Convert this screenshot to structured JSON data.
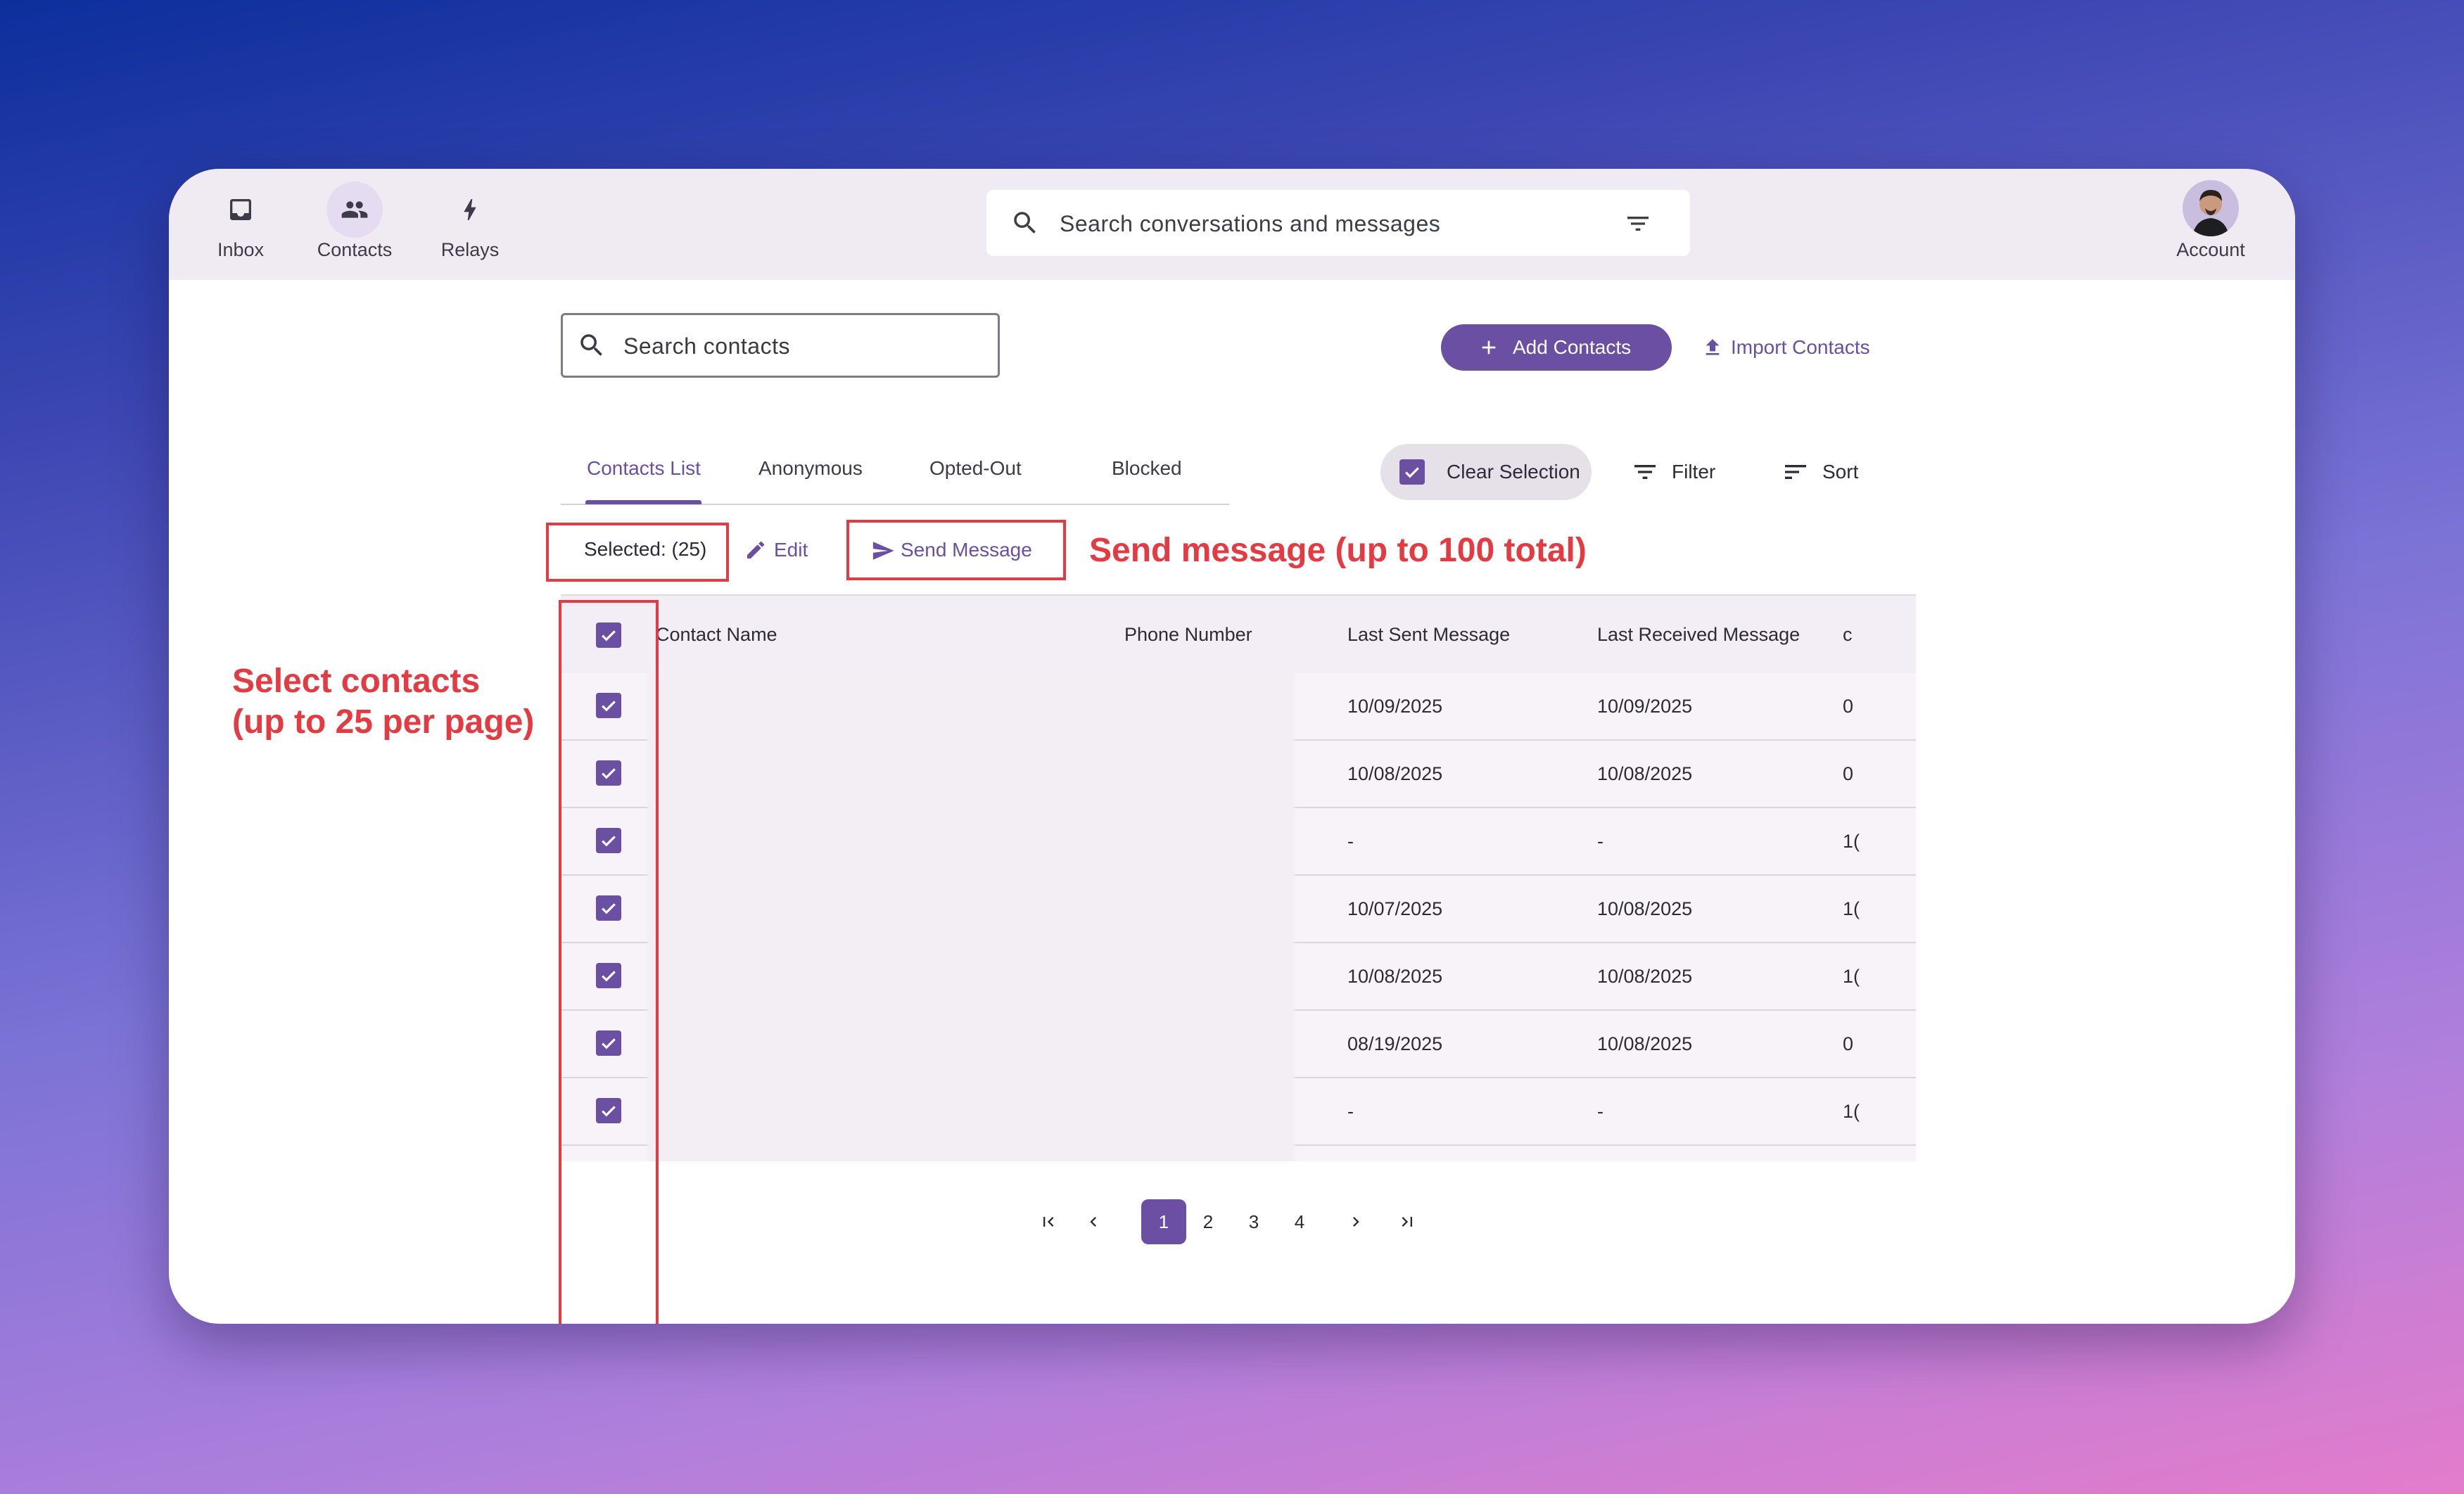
{
  "nav": {
    "items": [
      {
        "label": "Inbox",
        "icon": "inbox-icon"
      },
      {
        "label": "Contacts",
        "icon": "contacts-icon",
        "active": true
      },
      {
        "label": "Relays",
        "icon": "bolt-icon"
      }
    ],
    "search_placeholder": "Search conversations and messages",
    "account_label": "Account"
  },
  "toolbar": {
    "contact_search_placeholder": "Search contacts",
    "add_contacts_label": "Add Contacts",
    "import_contacts_label": "Import Contacts"
  },
  "tabs": [
    {
      "label": "Contacts List",
      "active": true
    },
    {
      "label": "Anonymous"
    },
    {
      "label": "Opted-Out"
    },
    {
      "label": "Blocked"
    }
  ],
  "actions": {
    "clear_selection_label": "Clear Selection",
    "filter_label": "Filter",
    "sort_label": "Sort",
    "selected_label": "Selected: (25)",
    "edit_label": "Edit",
    "send_message_label": "Send Message"
  },
  "table": {
    "headers": [
      "Contact Name",
      "Phone Number",
      "Last Sent Message",
      "Last Received Message",
      "c"
    ],
    "rows": [
      {
        "last_sent": "10/09/2025",
        "last_received": "10/09/2025",
        "extra": "0"
      },
      {
        "last_sent": "10/08/2025",
        "last_received": "10/08/2025",
        "extra": "0"
      },
      {
        "last_sent": "-",
        "last_received": "-",
        "extra": "1("
      },
      {
        "last_sent": "10/07/2025",
        "last_received": "10/08/2025",
        "extra": "1("
      },
      {
        "last_sent": "10/08/2025",
        "last_received": "10/08/2025",
        "extra": "1("
      },
      {
        "last_sent": "08/19/2025",
        "last_received": "10/08/2025",
        "extra": "0"
      },
      {
        "last_sent": "-",
        "last_received": "-",
        "extra": "1("
      }
    ]
  },
  "pagination": {
    "pages": [
      "1",
      "2",
      "3",
      "4"
    ],
    "current": "1"
  },
  "annotations": {
    "send_message_note": "Send message (up to 100 total)",
    "select_note_line1": "Select contacts",
    "select_note_line2": "(up to 25 per page)"
  },
  "colors": {
    "accent": "#6a4fa3",
    "annotation_red": "#e43a42",
    "topbar_bg": "#f0ebf2"
  }
}
